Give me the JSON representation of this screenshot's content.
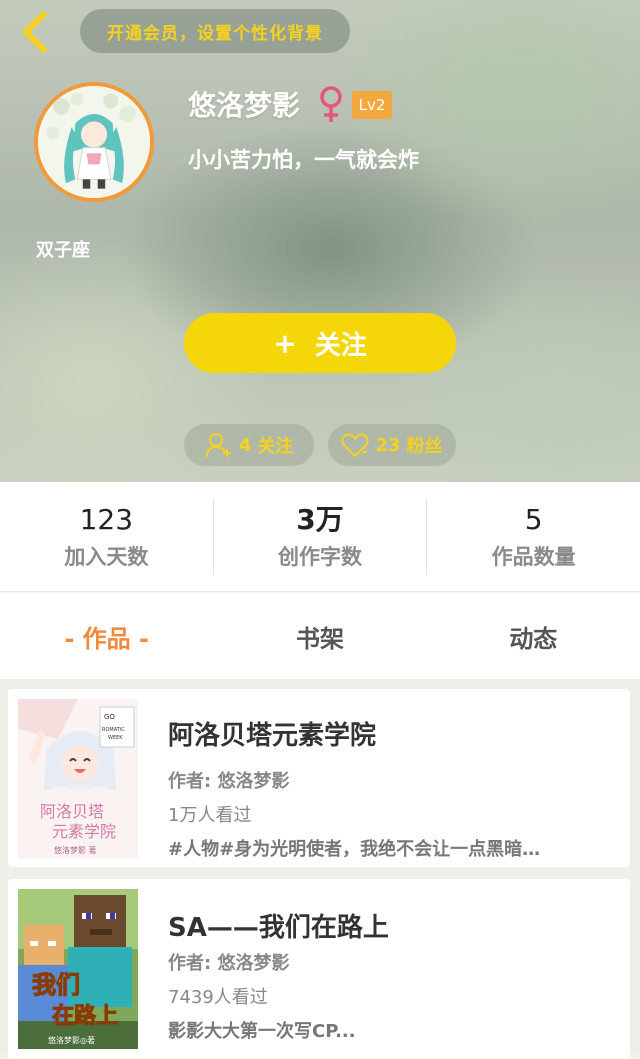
{
  "header": {
    "vip_banner": "开通会员，设置个性化背景",
    "username": "悠洛梦影",
    "level": "Lv2",
    "bio": "小小苦力怕，一气就会炸",
    "zodiac": "双子座",
    "follow_button": {
      "plus": "+",
      "label": "关注"
    },
    "following": {
      "count": "4",
      "label": "关注"
    },
    "fans": {
      "count": "23",
      "label": "粉丝"
    }
  },
  "stats": [
    {
      "value": "123",
      "label": "加入天数"
    },
    {
      "value": "3万",
      "label": "创作字数"
    },
    {
      "value": "5",
      "label": "作品数量"
    }
  ],
  "tabs": [
    {
      "label": "- 作品 -",
      "active": true
    },
    {
      "label": "书架",
      "active": false
    },
    {
      "label": "动态",
      "active": false
    }
  ],
  "works": [
    {
      "title": "阿洛贝塔元素学院",
      "author": "作者: 悠洛梦影",
      "views": "1万人看过",
      "desc": "#人物#身为光明使者，我绝不会让一点黑暗…",
      "cover_text": {
        "go": "GO",
        "romantic": "ROMATIC",
        "week": "WEEK",
        "line1": "阿洛贝塔",
        "line2": "元素学院",
        "line3": "悠洛梦影  著"
      }
    },
    {
      "title": "SA——我们在路上",
      "author": "作者: 悠洛梦影",
      "views": "7439人看过",
      "desc": "影影大大第一次写CP...",
      "cover_text": {
        "line1": "我们",
        "line2": "在路上",
        "line3": "悠洛梦影◎著"
      }
    }
  ],
  "colors": {
    "accent_yellow": "#f5d60a",
    "accent_orange": "#f0893a",
    "level_badge": "#f3a83e",
    "female_icon": "#e4577a"
  }
}
